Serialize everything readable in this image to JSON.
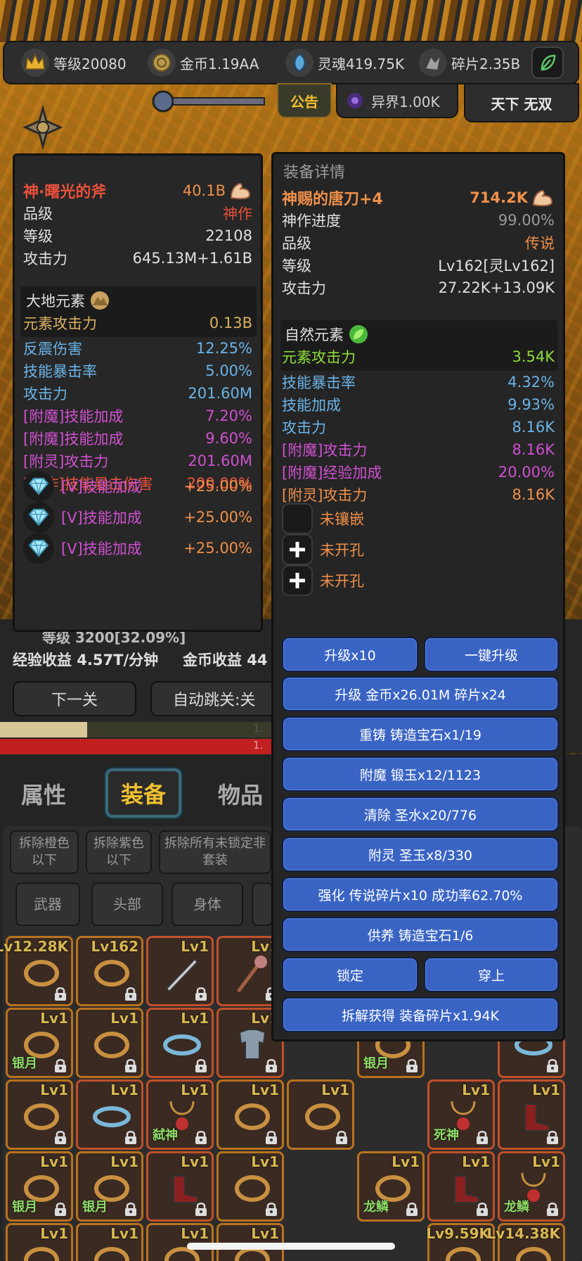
{
  "colors": {
    "accent_blue": "#3a64c4",
    "god_red": "#e8503a",
    "legend_orange": "#f0904a",
    "enchant_pink": "#d050d0",
    "nature_green": "#8fdc3a",
    "stat_blue": "#6ab4e8"
  },
  "resources": [
    {
      "icon": "crown-icon",
      "text": "等级20080"
    },
    {
      "icon": "coin-icon",
      "text": "金币1.19AA"
    },
    {
      "icon": "soul-icon",
      "text": "灵魂419.75K"
    },
    {
      "icon": "shard-icon",
      "text": "碎片2.35B"
    }
  ],
  "topbar": {
    "notice": "公告",
    "otherworld": "异界1.00K",
    "title": "天下 无双"
  },
  "left_panel": {
    "name": "神·曙光的斧",
    "power": "40.1B",
    "stats": [
      {
        "label": "品级",
        "value": "神作"
      },
      {
        "label": "等级",
        "value": "22108"
      },
      {
        "label": "攻击力",
        "value": "645.13M+1.61B"
      }
    ],
    "element": {
      "name": "大地元素",
      "label": "元素攻击力",
      "value": "0.13B"
    },
    "affixes": [
      {
        "label": "反震伤害",
        "value": "12.25%"
      },
      {
        "label": "技能暴击率",
        "value": "5.00%"
      },
      {
        "label": "攻击力",
        "value": "201.60M"
      },
      {
        "label": "[附魔]技能加成",
        "value": "7.20%"
      },
      {
        "label": "[附魔]技能加成",
        "value": "9.60%"
      },
      {
        "label": "[附灵]攻击力",
        "value": "201.60M"
      },
      {
        "label": "[神作]技能暴击伤害",
        "value": "200.00%"
      }
    ],
    "gems": [
      {
        "label": "[V]技能加成",
        "value": "+25.00%"
      },
      {
        "label": "[V]技能加成",
        "value": "+25.00%"
      },
      {
        "label": "[V]技能加成",
        "value": "+25.00%"
      }
    ]
  },
  "right_panel": {
    "title": "装备详情",
    "name": "神赐的唐刀+4",
    "power": "714.2K",
    "stats": [
      {
        "label": "神作进度",
        "value": "99.00%"
      },
      {
        "label": "品级",
        "value": "传说"
      },
      {
        "label": "等级",
        "value": "Lv162[灵Lv162]"
      },
      {
        "label": "攻击力",
        "value": "27.22K+13.09K"
      }
    ],
    "element": {
      "name": "自然元素",
      "label": "元素攻击力",
      "value": "3.54K"
    },
    "affixes": [
      {
        "label": "技能暴击率",
        "value": "4.32%"
      },
      {
        "label": "技能加成",
        "value": "9.93%"
      },
      {
        "label": "攻击力",
        "value": "8.16K"
      },
      {
        "label": "[附魔]攻击力",
        "value": "8.16K"
      },
      {
        "label": "[附魔]经验加成",
        "value": "20.00%"
      },
      {
        "label": "[附灵]攻击力",
        "value": "8.16K"
      }
    ],
    "sockets": [
      "未镶嵌",
      "未开孔",
      "未开孔"
    ],
    "buttons": {
      "upgrade10": "升级x10",
      "upgrade_one": "一键升级",
      "upgrade_cost": "升级 金币x26.01M 碎片x24",
      "recast": "重铸 铸造宝石x1/19",
      "enchant": "附魔 锻玉x12/1123",
      "clear": "清除 圣水x20/776",
      "spirit": "附灵 圣玉x8/330",
      "strengthen": "强化 传说碎片x10 成功率62.70%",
      "nurture": "供养 铸造宝石1/6",
      "lock": "锁定",
      "equip": "穿上",
      "dismantle": "拆解获得 装备碎片x1.94K"
    }
  },
  "behind": {
    "level_fragment": "等级 3200[32.09%]",
    "exp_rate": "经验收益 4.57T/分钟",
    "gold_rate": "金币收益 44",
    "next_stage": "下一关",
    "auto_skip": "自动跳关:关",
    "progress": 0.31,
    "progress_label": "1.",
    "progress_label2": "1."
  },
  "tabs": [
    "属性",
    "装备",
    "物品"
  ],
  "filters": [
    "拆除橙色以下",
    "拆除紫色以下",
    "拆除所有未锁定非套装"
  ],
  "categories": [
    "武器",
    "头部",
    "身体"
  ],
  "inventory": [
    {
      "lv": "Lv12.28K",
      "name": ""
    },
    {
      "lv": "Lv162",
      "name": ""
    },
    {
      "lv": "Lv1",
      "name": ""
    },
    {
      "lv": "Lv1",
      "name": ""
    },
    {
      "lv": "Lv1",
      "name": "银月"
    },
    {
      "lv": "Lv1",
      "name": ""
    },
    {
      "lv": "Lv1",
      "name": ""
    },
    {
      "lv": "Lv1",
      "name": ""
    },
    {
      "lv": "Lv1",
      "name": ""
    },
    {
      "lv": "Lv1",
      "name": ""
    },
    {
      "lv": "Lv1",
      "name": "弑神"
    },
    {
      "lv": "Lv1",
      "name": ""
    },
    {
      "lv": "Lv1",
      "name": "银月"
    },
    {
      "lv": "Lv1",
      "name": "银月"
    },
    {
      "lv": "Lv1",
      "name": ""
    },
    {
      "lv": "Lv1",
      "name": ""
    },
    {
      "lv": "Lv1",
      "name": ""
    },
    {
      "lv": "Lv1",
      "name": ""
    },
    {
      "lv": "Lv1",
      "name": ""
    },
    {
      "lv": "Lv1",
      "name": ""
    }
  ],
  "inventory_right": [
    {
      "lv": "Lv1",
      "name": "银月"
    },
    {
      "lv": "Lv1",
      "name": ""
    },
    {
      "lv": "Lv1",
      "name": ""
    },
    {
      "lv": "Lv1",
      "name": "死神"
    },
    {
      "lv": "Lv1",
      "name": ""
    },
    {
      "lv": "Lv1",
      "name": "龙鳞"
    },
    {
      "lv": "Lv1",
      "name": ""
    },
    {
      "lv": "Lv1",
      "name": "龙鳞"
    },
    {
      "lv": "Lv9.59K",
      "name": ""
    },
    {
      "lv": "Lv14.38K",
      "name": ""
    }
  ]
}
